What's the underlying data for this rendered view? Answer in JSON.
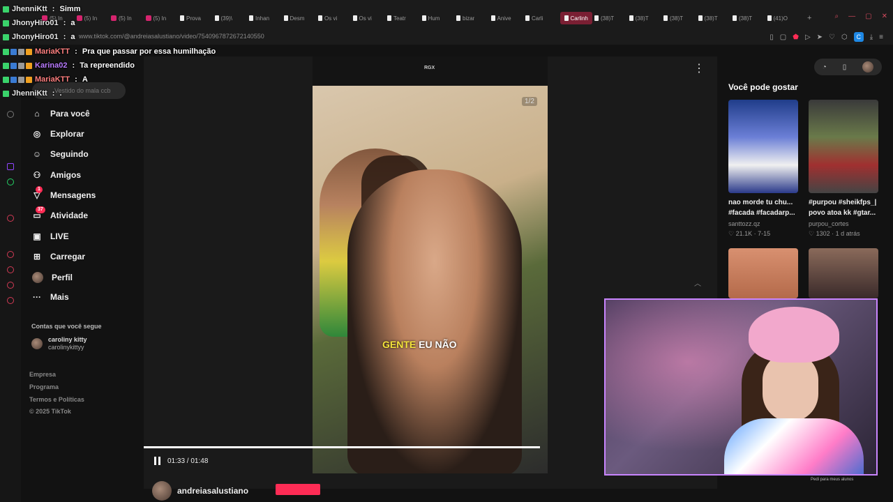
{
  "browser": {
    "tabs": [
      {
        "label": "(5) In",
        "icon": "instagram"
      },
      {
        "label": "(5) In",
        "icon": "instagram"
      },
      {
        "label": "(5) In",
        "icon": "instagram"
      },
      {
        "label": "(5) In",
        "icon": "instagram"
      },
      {
        "label": "Prova",
        "icon": "tiktok"
      },
      {
        "label": "(39)\\",
        "icon": "tiktok"
      },
      {
        "label": "Inhan",
        "icon": "tiktok"
      },
      {
        "label": "Desm",
        "icon": "tiktok"
      },
      {
        "label": "Os vi",
        "icon": "tiktok"
      },
      {
        "label": "Os vi",
        "icon": "tiktok"
      },
      {
        "label": "Teatr",
        "icon": "tiktok"
      },
      {
        "label": "Hum",
        "icon": "tiktok"
      },
      {
        "label": "bizar",
        "icon": "tiktok"
      },
      {
        "label": "Anive",
        "icon": "tiktok"
      },
      {
        "label": "Carli",
        "icon": "tiktok"
      },
      {
        "label": "Carlinh",
        "icon": "tiktok",
        "active": true
      },
      {
        "label": "(38)T",
        "icon": "tiktok"
      },
      {
        "label": "(38)T",
        "icon": "tiktok"
      },
      {
        "label": "(38)T",
        "icon": "tiktok"
      },
      {
        "label": "(38)T",
        "icon": "tiktok"
      },
      {
        "label": "(38)T",
        "icon": "tiktok"
      },
      {
        "label": "(41)O",
        "icon": "tiktok"
      }
    ],
    "new_tab": "+",
    "url": "www.tiktok.com/@andreiasalustiano/video/7540967872672140550",
    "ext_badge": "C"
  },
  "chat": [
    {
      "name": "JhenniKtt",
      "sep": " : ",
      "msg": "Simm",
      "color": "g"
    },
    {
      "name": "JhonyHiro01",
      "sep": " : ",
      "msg": "a",
      "color": "g"
    },
    {
      "name": "JhonyHiro01",
      "sep": " : ",
      "msg": "a",
      "color": "g"
    },
    {
      "name": "MariaKTT",
      "sep": " : ",
      "msg": "Pra que passar por essa humilhação",
      "color": "m"
    },
    {
      "name": "Karina02",
      "sep": " : ",
      "msg": "Ta repreendido",
      "color": "k"
    },
    {
      "name": "MariaKTT",
      "sep": " : ",
      "msg": "A",
      "color": "m"
    },
    {
      "name": "JhenniKtt",
      "sep": " : ",
      "msg": ".",
      "color": "g"
    }
  ],
  "sidebar": {
    "search_placeholder": "Vestido do mala ccb",
    "items": [
      {
        "label": "Para você",
        "icon": "home-icon"
      },
      {
        "label": "Explorar",
        "icon": "compass-icon"
      },
      {
        "label": "Seguindo",
        "icon": "user-plus-icon"
      },
      {
        "label": "Amigos",
        "icon": "users-icon"
      },
      {
        "label": "Mensagens",
        "icon": "message-icon",
        "badge": "1"
      },
      {
        "label": "Atividade",
        "icon": "activity-icon",
        "badge": "37"
      },
      {
        "label": "LIVE",
        "icon": "live-icon"
      },
      {
        "label": "Carregar",
        "icon": "upload-icon"
      },
      {
        "label": "Perfil",
        "icon": "avatar-icon"
      },
      {
        "label": "Mais",
        "icon": "more-icon"
      }
    ],
    "following_heading": "Contas que você segue",
    "following": {
      "name": "caroliny kitty",
      "handle": "carolinykittyy"
    },
    "footer": [
      "Empresa",
      "Programa",
      "Termos e Políticas",
      "© 2025 TikTok"
    ]
  },
  "video": {
    "watermark": "RGX",
    "page_indicator": "1/2",
    "caption_highlight": "GENTE",
    "caption_rest": " EU NÃO",
    "time": "01:33 / 01:48",
    "progress": 0.86,
    "author": "andreiasalustiano"
  },
  "recommendations": {
    "title": "Você pode gostar",
    "items": [
      {
        "title_line1": "nao morde tu chu...",
        "title_line2": "#facada #facadarp...",
        "user": "santtozz.qz",
        "stats": "♡ 21.1K · 7-15"
      },
      {
        "title_line1": "#purpou #sheikfps_|",
        "title_line2": "povo atoa kk #gtar...",
        "user": "purpou_cortes",
        "stats": "♡ 1302 · 1 d atrás"
      }
    ],
    "thumb_caption": "Pedi para meus alunos"
  },
  "colors": {
    "accent": "#fe2c55",
    "active_tab": "#7a1f33",
    "webcam_border": "#c985ff"
  }
}
